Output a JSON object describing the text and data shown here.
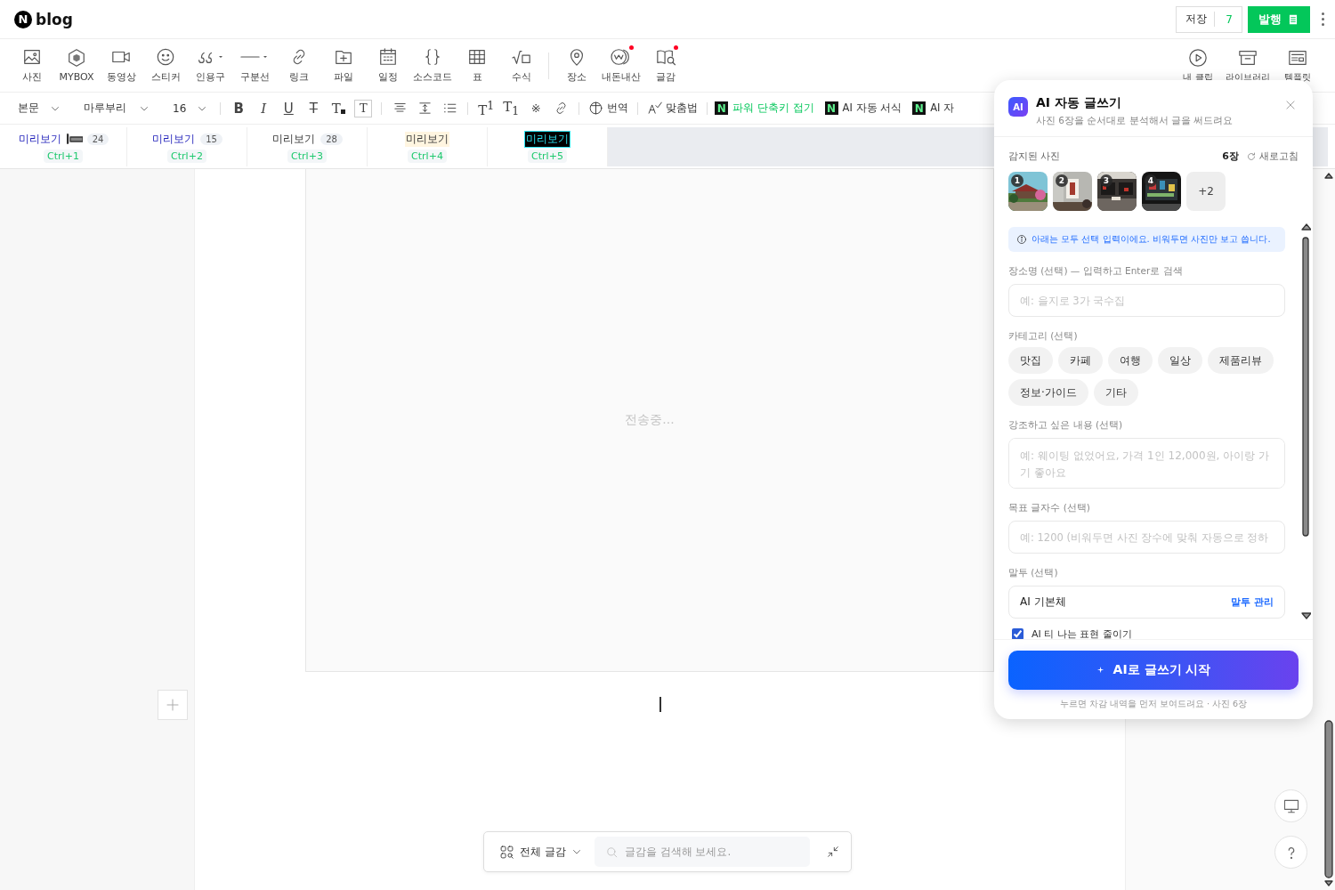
{
  "header": {
    "logo_mark": "N",
    "logo_text": "blog",
    "save_label": "저장",
    "save_count": "7",
    "publish": "발행"
  },
  "toolbar": {
    "items": [
      {
        "label": "사진",
        "dropdown": false,
        "dot": false
      },
      {
        "label": "MYBOX",
        "dropdown": false,
        "dot": false
      },
      {
        "label": "동영상",
        "dropdown": false,
        "dot": false
      },
      {
        "label": "스티커",
        "dropdown": false,
        "dot": false
      },
      {
        "label": "인용구",
        "dropdown": true,
        "dot": false
      },
      {
        "label": "구분선",
        "dropdown": true,
        "dot": false
      },
      {
        "label": "링크",
        "dropdown": false,
        "dot": false
      },
      {
        "label": "파일",
        "dropdown": false,
        "dot": false
      },
      {
        "label": "일정",
        "dropdown": false,
        "dot": false
      },
      {
        "label": "소스코드",
        "dropdown": false,
        "dot": false
      },
      {
        "label": "표",
        "dropdown": false,
        "dot": false
      },
      {
        "label": "수식",
        "dropdown": false,
        "dot": false
      },
      {
        "label": "장소",
        "dropdown": false,
        "dot": false
      },
      {
        "label": "내돈내산",
        "dropdown": false,
        "dot": true
      },
      {
        "label": "글감",
        "dropdown": false,
        "dot": true
      }
    ],
    "right_items": [
      "내 클립",
      "라이브러리",
      "템플릿"
    ]
  },
  "format_bar": {
    "selects": [
      "본문",
      "마루부리",
      "16"
    ],
    "button_groups": [
      [
        {
          "kind": "bold",
          "text": "B"
        },
        {
          "kind": "italic",
          "text": "I"
        },
        {
          "kind": "underline",
          "text": "U"
        },
        {
          "kind": "strike",
          "text": "T"
        },
        {
          "kind": "color",
          "text": "T"
        },
        {
          "kind": "background",
          "text": "T"
        }
      ],
      [
        {
          "kind": "align"
        },
        {
          "kind": "line_height"
        },
        {
          "kind": "list"
        }
      ],
      [
        {
          "kind": "superscript",
          "text": "T$^{1}$"
        },
        {
          "kind": "subscript",
          "text": "T$_{1}$"
        },
        {
          "kind": "symbol",
          "text": "※"
        },
        {
          "kind": "link"
        }
      ]
    ],
    "actions": [
      {
        "kind": "translate",
        "label": "번역"
      },
      {
        "kind": "spell",
        "label": "맞춤법"
      }
    ],
    "plugins": [
      {
        "mark": "N",
        "label": "파워 단축키 접기",
        "accent": true
      },
      {
        "mark": "N",
        "label": "AI 자동 서식",
        "accent": false
      },
      {
        "mark": "N",
        "label": "AI 자",
        "accent": false
      }
    ]
  },
  "preview_tabs": [
    {
      "label": "미리보기",
      "marker": true,
      "count": "24",
      "shortcut": "Ctrl+1"
    },
    {
      "label": "미리보기",
      "marker": false,
      "count": "15",
      "shortcut": "Ctrl+2"
    },
    {
      "label": "미리보기",
      "marker": false,
      "count": "28",
      "shortcut": "Ctrl+3"
    },
    {
      "label": "미리보기",
      "marker": false,
      "shortcut": "Ctrl+4"
    },
    {
      "label": "미리보기",
      "marker": false,
      "shortcut": "Ctrl+5"
    }
  ],
  "editor": {
    "status": "전송중..."
  },
  "material_bar": {
    "filter": "전체 글감",
    "search_placeholder": "글감을 검색해 보세요."
  },
  "ai_panel": {
    "badge": "AI",
    "title": "AI 자동 글쓰기",
    "subtitle": "사진 6장을 순서대로 분석해서 글을 써드려요",
    "photos_label": "감지된 사진",
    "photo_count": "6장",
    "refresh": "새로고침",
    "photos": [
      {
        "number": "1"
      },
      {
        "number": "2"
      },
      {
        "number": "3"
      },
      {
        "number": "4"
      }
    ],
    "more": "+2",
    "notice": "아래는 모두 선택 입력이에요. 비워두면 사진만 보고 씁니다.",
    "fields": [
      {
        "kind": "input",
        "label": "장소명 (선택) — 입력하고 Enter로 검색",
        "placeholder": "예: 을지로 3가 국수집"
      },
      {
        "kind": "chips",
        "label": "카테고리 (선택)",
        "options": [
          {
            "label": "맛집",
            "selected": false
          },
          {
            "label": "카페",
            "selected": false
          },
          {
            "label": "여행",
            "selected": false
          },
          {
            "label": "일상",
            "selected": false
          },
          {
            "label": "제품리뷰",
            "selected": false
          },
          {
            "label": "정보·가이드",
            "selected": false
          },
          {
            "label": "기타",
            "selected": false
          }
        ]
      },
      {
        "kind": "textarea",
        "label": "강조하고 싶은 내용 (선택)",
        "placeholder": "예: 웨이팅 없었어요, 가격 1인 12,000원, 아이랑 가기 좋아요"
      },
      {
        "kind": "input",
        "label": "목표 글자수 (선택)",
        "placeholder": "예: 1200 (비워두면 사진 장수에 맞춰 자동으로 정하"
      },
      {
        "kind": "select",
        "label": "말투 (선택)",
        "value": "AI 기본체",
        "action": "말투 관리"
      },
      {
        "kind": "checkbox",
        "label": "AI 티 나는 표현 줄이기",
        "checked": true
      }
    ],
    "start_button": "AI로 글쓰기 시작",
    "footnote": "누르면 차감 내역을 먼저 보여드려요 · 사진 6장"
  }
}
